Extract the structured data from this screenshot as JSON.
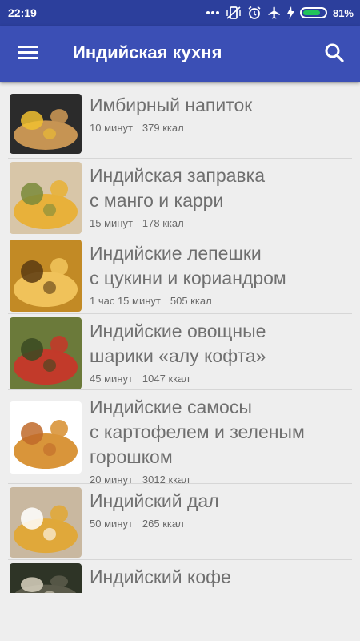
{
  "status_bar": {
    "time": "22:19",
    "battery_level": 0.81,
    "battery_text": "81%"
  },
  "app_bar": {
    "title": "Индийская кухня"
  },
  "recipes": [
    {
      "name_lines": [
        "Имбирный напиток"
      ],
      "time": "10 минут",
      "kcal": "379 ккал",
      "colors": [
        "#2b2b2b",
        "#c69453",
        "#f0c030"
      ]
    },
    {
      "name_lines": [
        "Индийская заправка",
        "с манго и карри"
      ],
      "time": "15 минут",
      "kcal": "178 ккал",
      "colors": [
        "#d8c6a8",
        "#e8b13a",
        "#7a8a3a"
      ]
    },
    {
      "name_lines": [
        "Индийские лепешки",
        "с цукини и кориандром"
      ],
      "time": "1 час 15 минут",
      "kcal": "505 ккал",
      "colors": [
        "#c28a25",
        "#f0c25a",
        "#5a3a12"
      ]
    },
    {
      "name_lines": [
        "Индийские овощные",
        "шарики «алу кофта»"
      ],
      "time": "45 минут",
      "kcal": "1047 ккал",
      "colors": [
        "#6b7a3a",
        "#c23a2a",
        "#3a4a22"
      ]
    },
    {
      "name_lines": [
        "Индийские самосы",
        "с картофелем и зеленым",
        "горошком"
      ],
      "time": "20 минут",
      "kcal": "3012 ккал",
      "colors": [
        "#ffffff",
        "#d9953a",
        "#c06a2a"
      ]
    },
    {
      "name_lines": [
        "Индийский дал"
      ],
      "time": "50 минут",
      "kcal": "265 ккал",
      "colors": [
        "#c9b8a0",
        "#e0a83a",
        "#ffffff"
      ]
    },
    {
      "name_lines": [
        "Индийский кофе"
      ],
      "time": "",
      "kcal": "",
      "colors": [
        "#2e3426",
        "#5a5a4a",
        "#d8d2c0"
      ]
    }
  ]
}
